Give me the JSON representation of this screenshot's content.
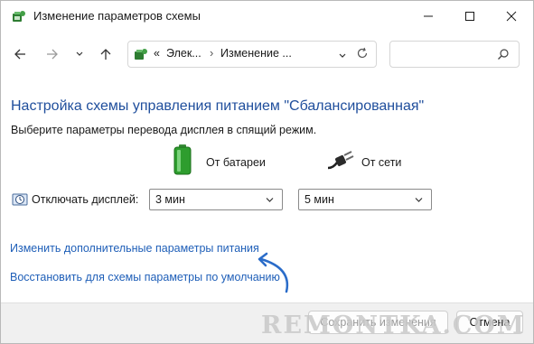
{
  "window": {
    "title": "Изменение параметров схемы"
  },
  "address": {
    "crumbs": [
      "«",
      "Элек...",
      "Изменение ..."
    ]
  },
  "content": {
    "heading": "Настройка схемы управления питанием \"Сбалансированная\"",
    "subtext": "Выберите параметры перевода дисплея в спящий режим.",
    "battery_label": "От батареи",
    "plugged_label": "От сети",
    "display_off_label": "Отключать дисплей:",
    "battery_value": "3 мин",
    "plugged_value": "5 мин",
    "link_advanced": "Изменить дополнительные параметры питания",
    "link_restore": "Восстановить для схемы параметры по умолчанию"
  },
  "footer": {
    "save_label": "Сохранить изменения",
    "cancel_label": "Отмена"
  },
  "watermark": "REMONTKA.COM",
  "colors": {
    "heading": "#1f4e9c",
    "link": "#1f5fb8",
    "arrow": "#2a6cc9"
  }
}
